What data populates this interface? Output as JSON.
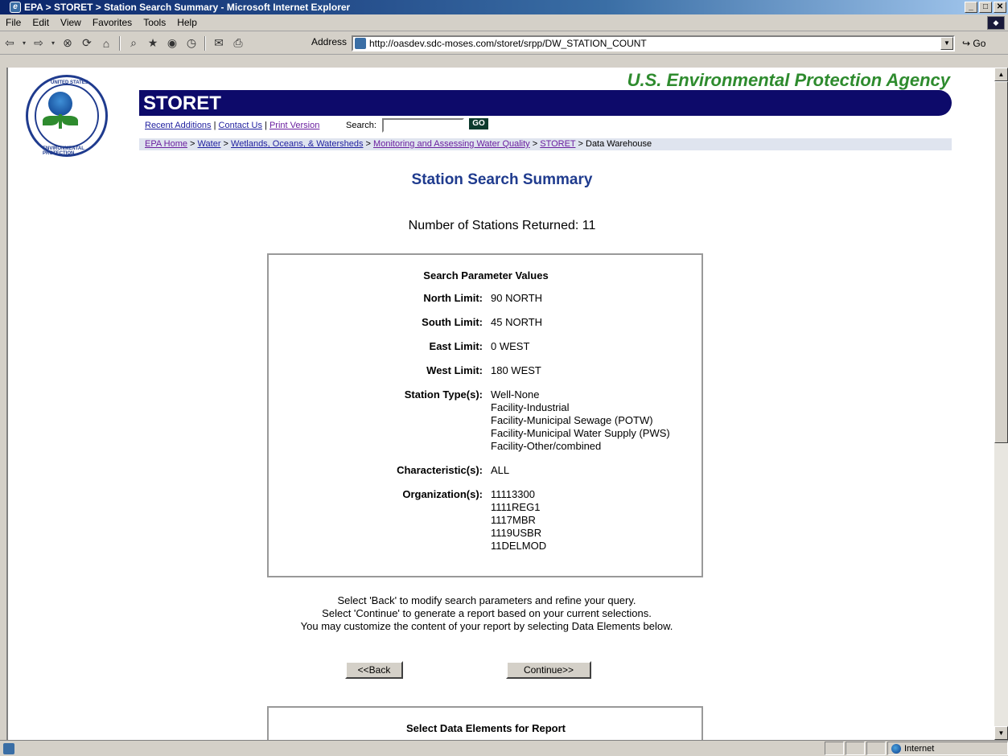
{
  "window": {
    "title": "EPA > STORET > Station Search Summary - Microsoft Internet Explorer"
  },
  "menu": [
    "File",
    "Edit",
    "View",
    "Favorites",
    "Tools",
    "Help"
  ],
  "address": {
    "label": "Address",
    "url": "http://oasdev.sdc-moses.com/storet/srpp/DW_STATION_COUNT",
    "go": "Go"
  },
  "header": {
    "agency": "U.S. Environmental Protection Agency",
    "program": "STORET",
    "links": {
      "recent": "Recent Additions",
      "contact": "Contact Us",
      "print": "Print Version",
      "sep": " | "
    },
    "search_label": "Search:",
    "go_label": "GO"
  },
  "breadcrumb": {
    "items": [
      "EPA Home",
      "Water",
      "Wetlands, Oceans, & Watersheds",
      "Monitoring and Assessing Water Quality",
      "STORET"
    ],
    "current": "Data Warehouse",
    "sep": " > "
  },
  "main": {
    "title": "Station Search Summary",
    "count_text": "Number of Stations Returned: 11"
  },
  "params": {
    "header": "Search Parameter Values",
    "rows": [
      {
        "label": "North Limit:",
        "values": [
          "90 NORTH"
        ]
      },
      {
        "label": "South Limit:",
        "values": [
          "45 NORTH"
        ]
      },
      {
        "label": "East Limit:",
        "values": [
          "0 WEST"
        ]
      },
      {
        "label": "West Limit:",
        "values": [
          "180 WEST"
        ]
      },
      {
        "label": "Station Type(s):",
        "values": [
          "Well-None",
          "Facility-Industrial",
          "Facility-Municipal Sewage (POTW)",
          "Facility-Municipal Water Supply (PWS)",
          "Facility-Other/combined"
        ]
      },
      {
        "label": "Characteristic(s):",
        "values": [
          "ALL"
        ]
      },
      {
        "label": "Organization(s):",
        "values": [
          "11113300",
          "1111REG1",
          "1117MBR",
          "1119USBR",
          "11DELMOD"
        ]
      }
    ]
  },
  "instructions": [
    "Select 'Back' to modify search parameters and refine your query.",
    "Select 'Continue' to generate a report based on your current selections.",
    "You may customize the content of your report by selecting Data Elements below."
  ],
  "buttons": {
    "back": "<<Back",
    "continue": "Continue>>"
  },
  "select_section": {
    "header": "Select Data Elements for Report"
  },
  "status": {
    "zone": "Internet"
  }
}
